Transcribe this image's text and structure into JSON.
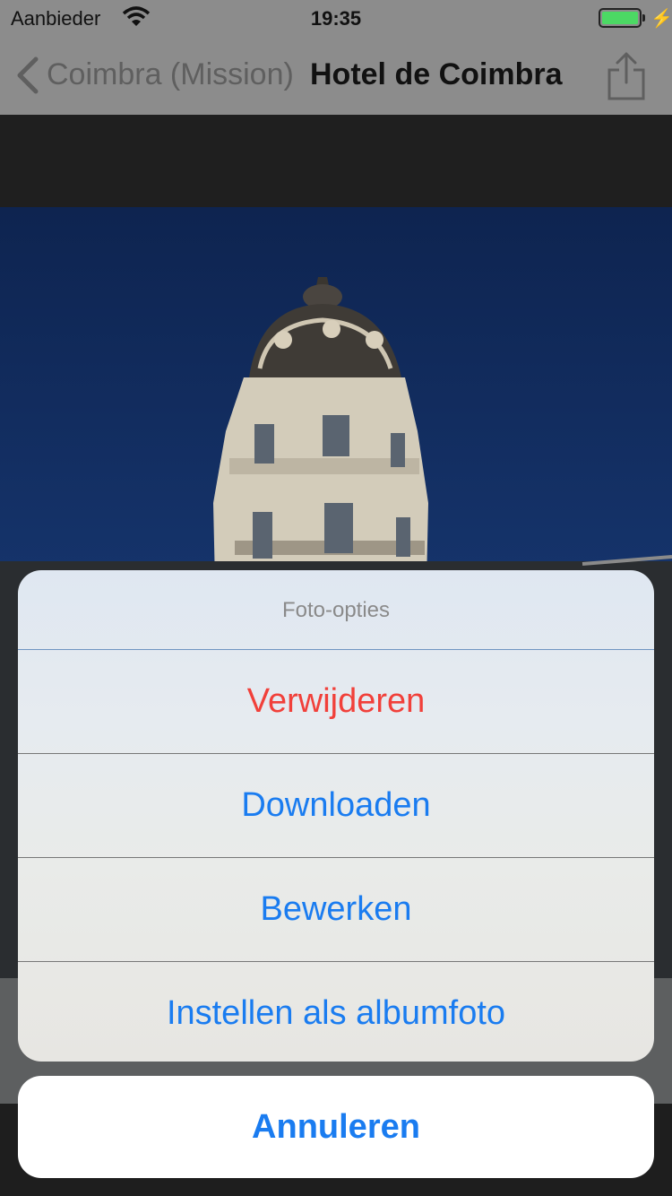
{
  "status_bar": {
    "carrier": "Aanbieder",
    "time": "19:35",
    "battery_level": 1.0,
    "battery_color": "#4cd964"
  },
  "nav": {
    "back_label": "Coimbra (Mission)",
    "title": "Hotel de Coimbra",
    "back_icon": "chevron-left-icon",
    "share_icon": "share-icon"
  },
  "action_sheet": {
    "title": "Foto-opties",
    "actions": [
      {
        "label": "Verwijderen",
        "style": "destructive",
        "color": "#f1403a"
      },
      {
        "label": "Downloaden",
        "style": "default",
        "color": "#1a7cf0"
      },
      {
        "label": "Bewerken",
        "style": "default",
        "color": "#1a7cf0"
      },
      {
        "label": "Instellen als albumfoto",
        "style": "default",
        "color": "#1a7cf0"
      }
    ],
    "cancel_label": "Annuleren"
  }
}
